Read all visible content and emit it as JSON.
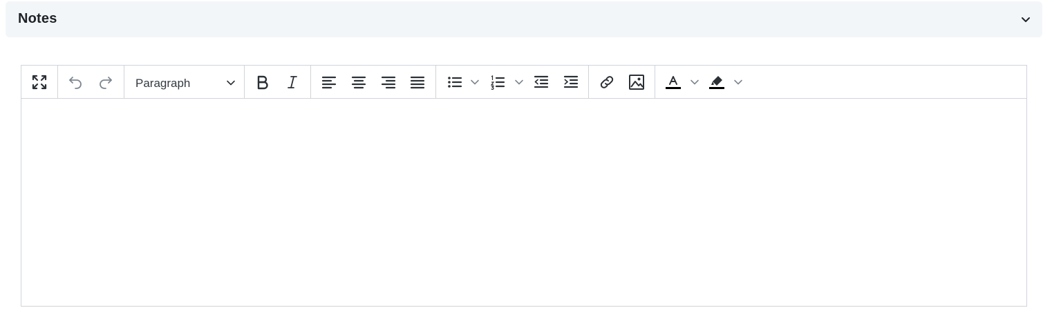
{
  "panel": {
    "title": "Notes",
    "collapse_icon": "chevron-down-icon"
  },
  "toolbar": {
    "fullscreen_icon": "fullscreen-icon",
    "undo_icon": "undo-icon",
    "redo_icon": "redo-icon",
    "block_format": {
      "selected": "Paragraph",
      "icon": "chevron-down-icon"
    },
    "bold_icon": "bold-icon",
    "italic_icon": "italic-icon",
    "align_left_icon": "align-left-icon",
    "align_center_icon": "align-center-icon",
    "align_right_icon": "align-right-icon",
    "align_justify_icon": "align-justify-icon",
    "bullet_list_icon": "bullet-list-icon",
    "numbered_list_icon": "numbered-list-icon",
    "outdent_icon": "outdent-icon",
    "indent_icon": "indent-icon",
    "link_icon": "link-icon",
    "image_icon": "image-icon",
    "text_color_icon": "font-color-icon",
    "highlight_color_icon": "highlighter-icon"
  },
  "editor": {
    "content": ""
  },
  "colors": {
    "header_bg": "#f3f6f9",
    "border": "#cfd4da",
    "icon": "#2b3035",
    "icon_disabled": "#7d8690"
  }
}
